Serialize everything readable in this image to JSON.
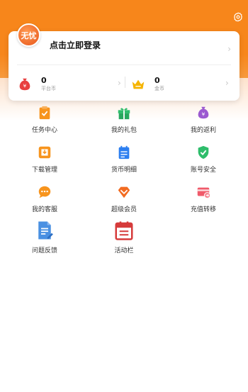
{
  "header": {
    "avatar_text": "无忧",
    "login_prompt": "点击立即登录"
  },
  "balances": [
    {
      "value": "0",
      "label": "平台币",
      "icon": "money-bag-icon",
      "color": "#e84040"
    },
    {
      "value": "0",
      "label": "金币",
      "icon": "crown-icon",
      "color": "#f5b400"
    }
  ],
  "menu": [
    {
      "label": "任务中心",
      "icon": "task-clipboard-icon",
      "color": "#f7941d"
    },
    {
      "label": "我的礼包",
      "icon": "gift-icon",
      "color": "#2ebd6b"
    },
    {
      "label": "我的返利",
      "icon": "rebate-bag-icon",
      "color": "#9b59d0"
    },
    {
      "label": "下载管理",
      "icon": "download-tray-icon",
      "color": "#f7941d"
    },
    {
      "label": "货币明细",
      "icon": "ledger-icon",
      "color": "#2d7ff0"
    },
    {
      "label": "账号安全",
      "icon": "shield-check-icon",
      "color": "#2ebd6b"
    },
    {
      "label": "我的客服",
      "icon": "chat-bubble-icon",
      "color": "#f7941d"
    },
    {
      "label": "超级会员",
      "icon": "diamond-icon",
      "color": "#f26b21"
    },
    {
      "label": "充值转移",
      "icon": "card-transfer-icon",
      "color": "#f05a6a"
    },
    {
      "label": "问题反馈",
      "icon": "feedback-doc-icon",
      "color": "#4a90e2"
    },
    {
      "label": "活动栏",
      "icon": "calendar-icon",
      "color": "#d63b3b"
    }
  ]
}
